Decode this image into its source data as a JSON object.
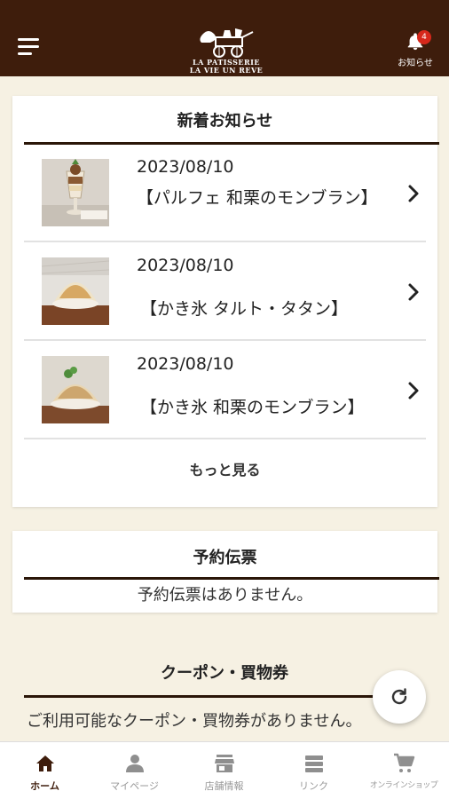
{
  "header": {
    "logo_line1": "LA PATISSERIE",
    "logo_line2": "LA VIE UN REVE",
    "notification_badge": "4",
    "notification_label": "お知らせ",
    "brand_color": "#3e1d0c"
  },
  "news": {
    "title": "新着お知らせ",
    "items": [
      {
        "date": "2023/08/10",
        "title": "【パルフェ 和栗のモンブラン】",
        "thumb": "parfait-photo"
      },
      {
        "date": "2023/08/10",
        "title": "【かき氷 タルト・タタン】",
        "thumb": "shaved-ice-tart-photo"
      },
      {
        "date": "2023/08/10",
        "title": "【かき氷 和栗のモンブラン】",
        "thumb": "shaved-ice-montblanc-photo"
      }
    ],
    "more_label": "もっと見る"
  },
  "reservation": {
    "title": "予約伝票",
    "empty_text": "予約伝票はありません。"
  },
  "coupon": {
    "title": "クーポン・買物券",
    "empty_text": "ご利用可能なクーポン・買物券がありません。"
  },
  "tabs": [
    {
      "label": "ホーム",
      "icon": "home-icon",
      "active": true
    },
    {
      "label": "マイページ",
      "icon": "person-icon",
      "active": false
    },
    {
      "label": "店舗情報",
      "icon": "store-icon",
      "active": false
    },
    {
      "label": "リンク",
      "icon": "list-icon",
      "active": false
    },
    {
      "label": "オンラインショップ",
      "icon": "cart-icon",
      "active": false
    }
  ]
}
